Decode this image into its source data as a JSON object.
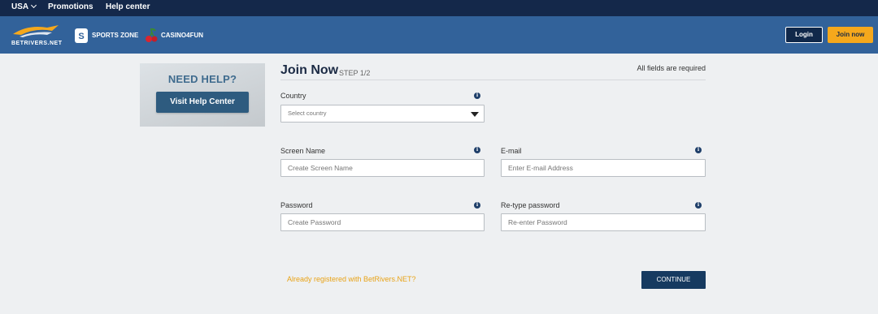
{
  "topbar": {
    "region": "USA",
    "promotions": "Promotions",
    "help_center": "Help center"
  },
  "header": {
    "logo_text": "BETRIVERS.NET",
    "sports_zone": "SPORTS ZONE",
    "casino": "CASINO4FUN",
    "login": "Login",
    "join_now": "Join now"
  },
  "help_card": {
    "title": "NEED HELP?",
    "button": "Visit Help Center"
  },
  "form": {
    "title": "Join Now",
    "step": "STEP 1/2",
    "required_note": "All fields are required",
    "country_label": "Country",
    "country_placeholder": "Select country",
    "screen_name_label": "Screen Name",
    "screen_name_placeholder": "Create Screen Name",
    "email_label": "E-mail",
    "email_placeholder": "Enter E-mail Address",
    "password_label": "Password",
    "password_placeholder": "Create Password",
    "retype_label": "Re-type password",
    "retype_placeholder": "Re-enter Password",
    "info_glyph": "i",
    "already_registered": "Already registered with BetRivers.NET?",
    "continue": "CONTINUE"
  },
  "colors": {
    "topbar": "#14284a",
    "header": "#32629a",
    "accent": "#f5a81c",
    "primary_button": "#163a60",
    "link": "#e8a317"
  }
}
